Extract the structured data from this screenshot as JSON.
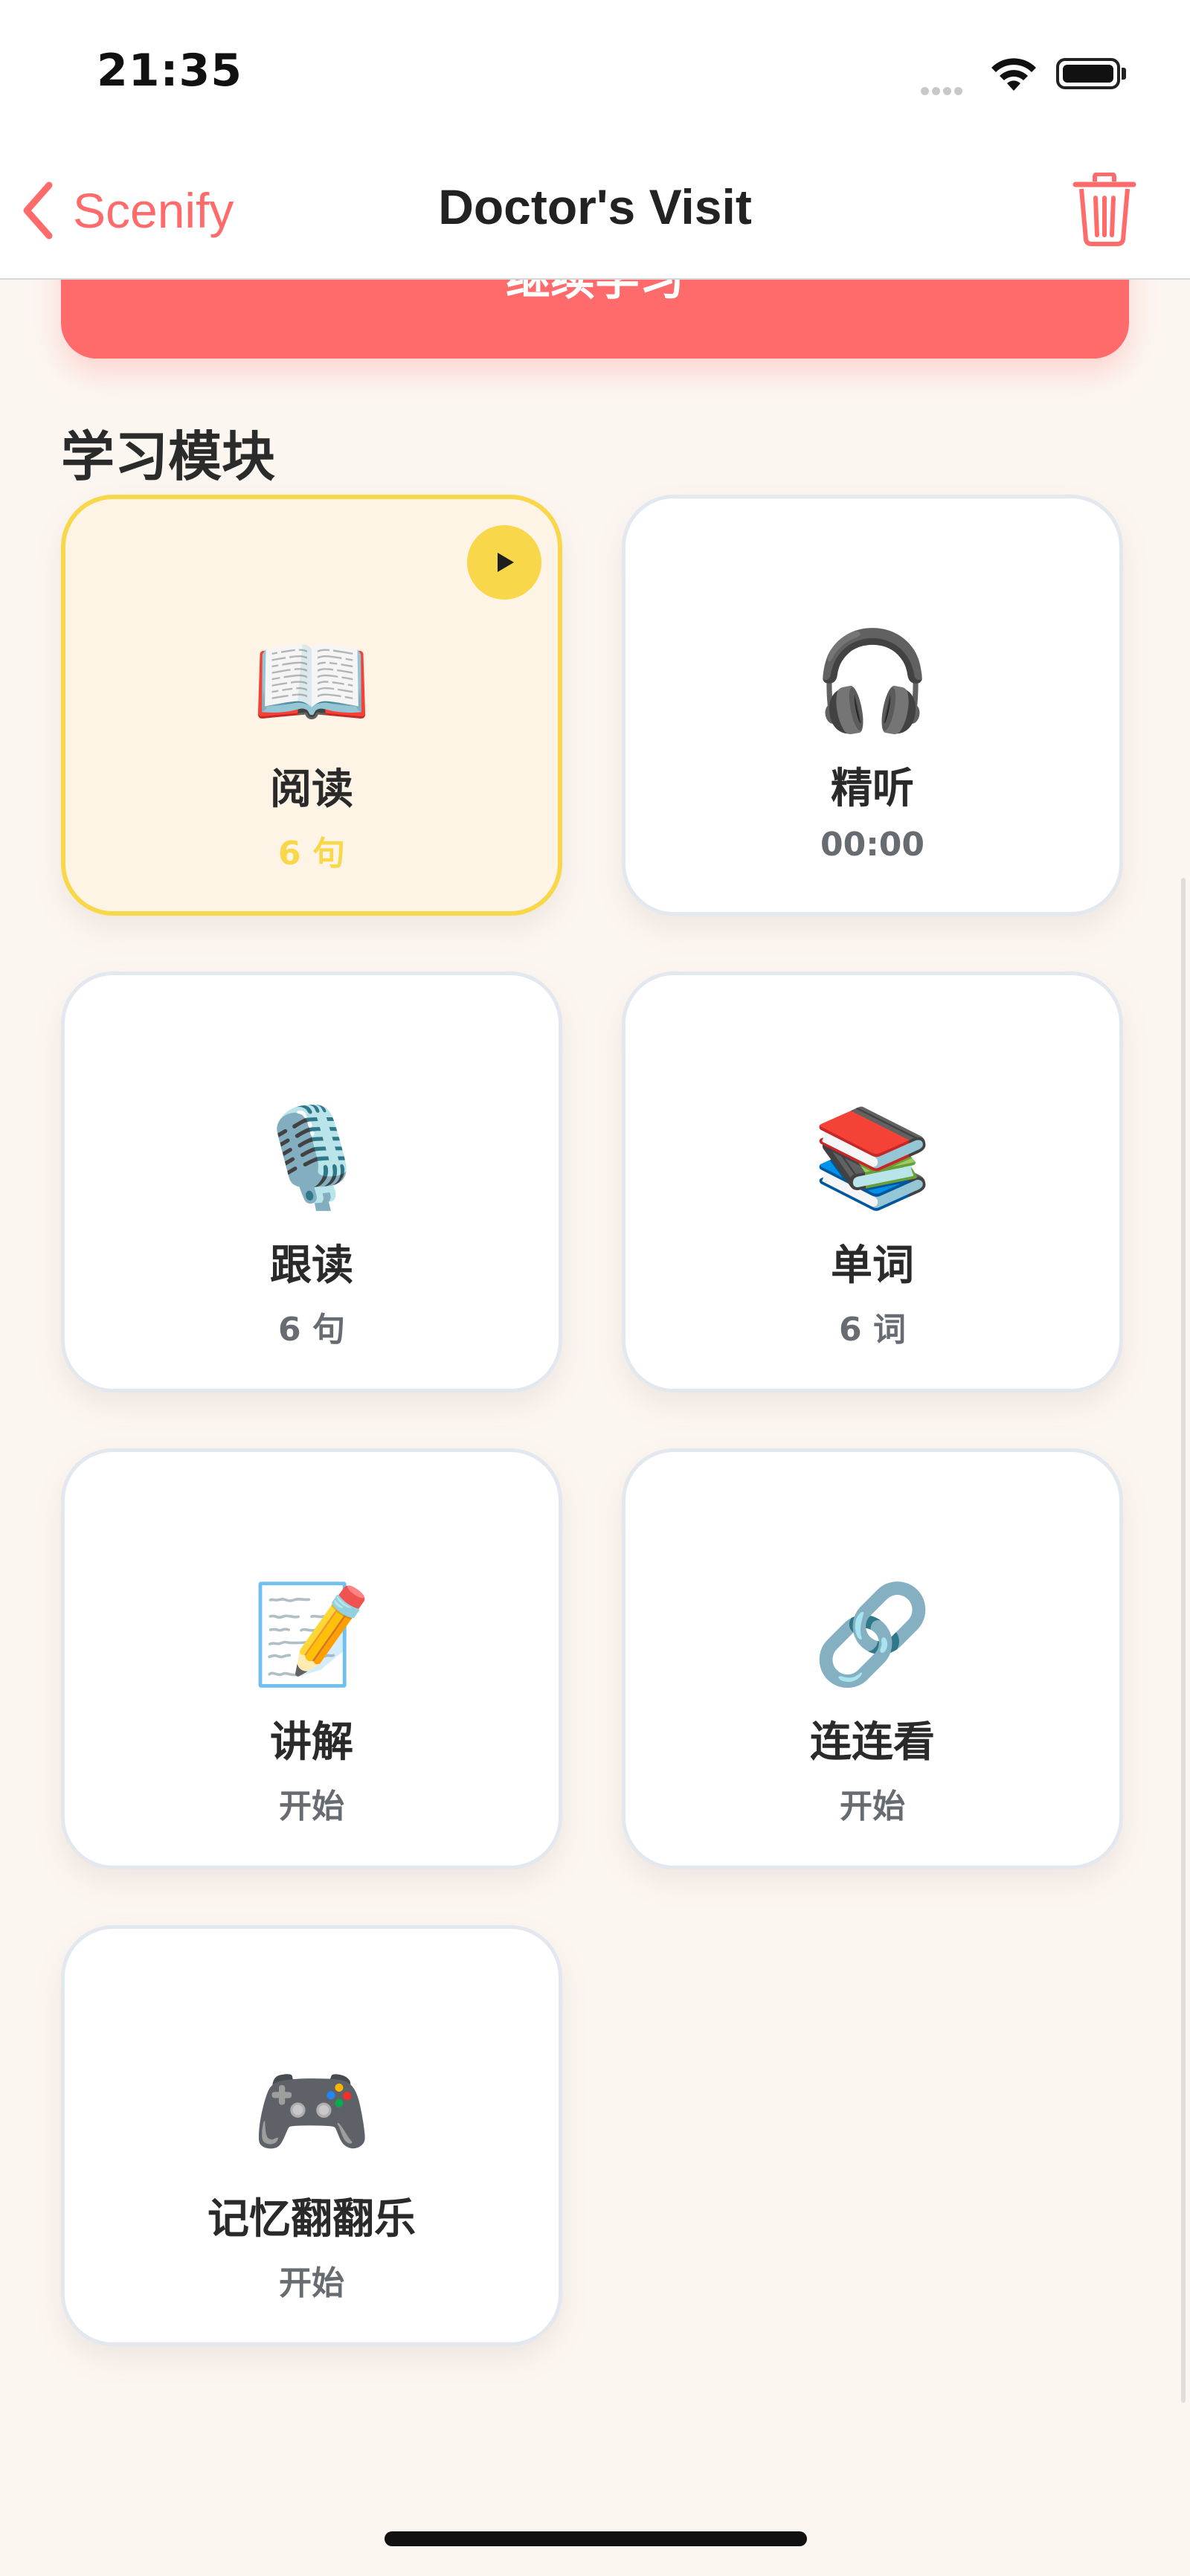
{
  "status_bar": {
    "time": "21:35"
  },
  "nav": {
    "back_label": "Scenify",
    "title": "Doctor's Visit"
  },
  "continue_button": {
    "label": "继续学习"
  },
  "section": {
    "title": "学习模块"
  },
  "modules": [
    {
      "icon": "📖",
      "icon_name": "open-book-icon",
      "title": "阅读",
      "subtitle": "6 句",
      "active": true
    },
    {
      "icon": "🎧",
      "icon_name": "headphones-icon",
      "title": "精听",
      "subtitle": "00:00",
      "active": false
    },
    {
      "icon": "🎙️",
      "icon_name": "microphone-icon",
      "title": "跟读",
      "subtitle": "6 句",
      "active": false
    },
    {
      "icon": "📚",
      "icon_name": "books-icon",
      "title": "单词",
      "subtitle": "6 词",
      "active": false
    },
    {
      "icon": "📝",
      "icon_name": "memo-icon",
      "title": "讲解",
      "subtitle": "开始",
      "active": false
    },
    {
      "icon": "🔗",
      "icon_name": "link-icon",
      "title": "连连看",
      "subtitle": "开始",
      "active": false
    },
    {
      "icon": "🎮",
      "icon_name": "gamepad-icon",
      "title": "记忆翻翻乐",
      "subtitle": "开始",
      "active": false
    }
  ],
  "colors": {
    "accent": "#ff6b6b",
    "active_border": "#f8d84a",
    "background": "#fcf6f1"
  }
}
